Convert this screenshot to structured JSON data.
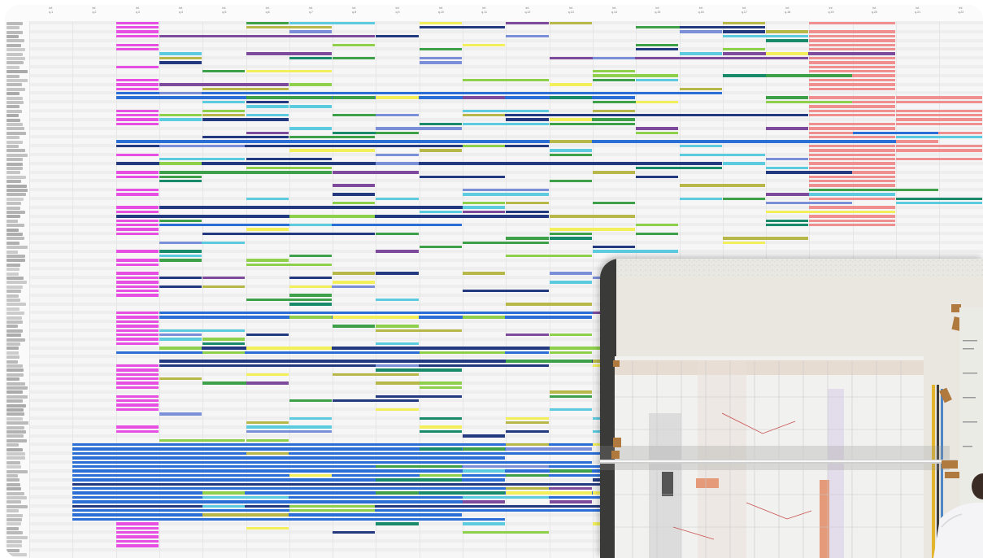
{
  "window": {
    "title": ""
  },
  "timeline": {
    "columns": [
      {
        "top": "Inf.",
        "bottom": "q.1"
      },
      {
        "top": "Inf.",
        "bottom": "q.2"
      },
      {
        "top": "Inf.",
        "bottom": "q.3"
      },
      {
        "top": "Inf.",
        "bottom": "q.4"
      },
      {
        "top": "Inf.",
        "bottom": "q.5"
      },
      {
        "top": "Inf.",
        "bottom": "q.6"
      },
      {
        "top": "Inf.",
        "bottom": "q.7"
      },
      {
        "top": "Inf.",
        "bottom": "q.8"
      },
      {
        "top": "Inf.",
        "bottom": "q.9"
      },
      {
        "top": "Inf.",
        "bottom": "q.10"
      },
      {
        "top": "Inf.",
        "bottom": "q.11"
      },
      {
        "top": "Inf.",
        "bottom": "q.12"
      },
      {
        "top": "Inf.",
        "bottom": "q.13"
      },
      {
        "top": "Inf.",
        "bottom": "q.14"
      },
      {
        "top": "Inf.",
        "bottom": "q.15"
      },
      {
        "top": "Inf.",
        "bottom": "q.16"
      },
      {
        "top": "Inf.",
        "bottom": "q.17"
      },
      {
        "top": "Inf.",
        "bottom": "q.18"
      },
      {
        "top": "Inf.",
        "bottom": "q.19"
      },
      {
        "top": "Inf.",
        "bottom": "q.20"
      },
      {
        "top": "Inf.",
        "bottom": "q.21"
      },
      {
        "top": "Inf.",
        "bottom": "q.22"
      }
    ]
  },
  "colors": {
    "magenta": "#e64fe1",
    "purple": "#7d4a9c",
    "blue": "#2a6ed6",
    "navy": "#233a80",
    "green": "#3fa04a",
    "lightgreen": "#8ed04c",
    "yellow": "#f2ef5a",
    "cyan": "#5ccbe0",
    "teal": "#1a8b6a",
    "salmon": "#ef8f8f",
    "periwinkle": "#7a8fd8",
    "olive": "#b8b84a"
  },
  "photo": {
    "description_icon": "whiteboard-photo"
  }
}
